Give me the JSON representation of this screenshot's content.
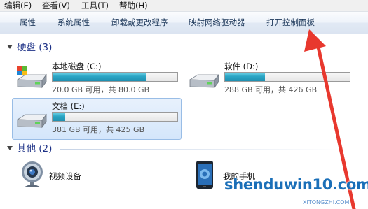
{
  "menu": [
    {
      "label": "编辑(E)"
    },
    {
      "label": "查看(V)"
    },
    {
      "label": "工具(T)"
    },
    {
      "label": "帮助(H)"
    }
  ],
  "toolbar": [
    {
      "label": "属性"
    },
    {
      "label": "系统属性"
    },
    {
      "label": "卸载或更改程序"
    },
    {
      "label": "映射网络驱动器"
    },
    {
      "label": "打开控制面板"
    }
  ],
  "groups": {
    "drives": {
      "title": "硬盘 (3)"
    },
    "other": {
      "title": "其他 (2)"
    }
  },
  "drives": [
    {
      "name": "本地磁盘 (C:)",
      "free": "20.0 GB 可用，共 80.0 GB",
      "used_fraction": 0.75,
      "selected": false
    },
    {
      "name": "软件 (D:)",
      "free": "288 GB 可用，共 426 GB",
      "used_fraction": 0.32,
      "selected": false
    },
    {
      "name": "文档 (E:)",
      "free": "381 GB 可用，共 425 GB",
      "used_fraction": 0.1,
      "selected": true
    }
  ],
  "devices": [
    {
      "label": "视频设备",
      "icon": "webcam-icon"
    },
    {
      "label": "我的手机",
      "icon": "phone-icon"
    }
  ],
  "watermark": {
    "text": "shenduwin10.com",
    "sub": "XITONGZHI.COM"
  },
  "colors": {
    "accent_arrow": "#e8382e",
    "bar_fill": "#2ba5c4",
    "group_title": "#1e3287"
  }
}
